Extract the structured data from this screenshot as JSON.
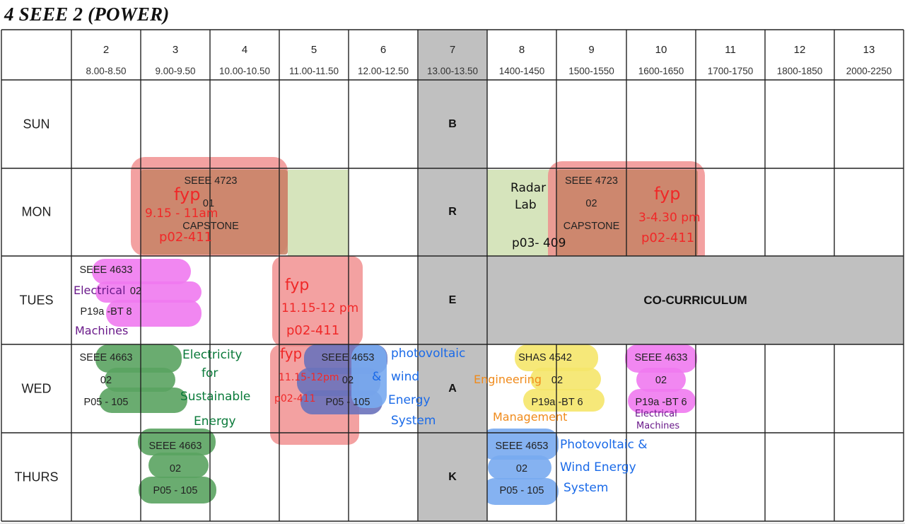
{
  "title": "4 SEEE 2 (POWER)",
  "periods": [
    {
      "num": "2",
      "time": "8.00-8.50"
    },
    {
      "num": "3",
      "time": "9.00-9.50"
    },
    {
      "num": "4",
      "time": "10.00-10.50"
    },
    {
      "num": "5",
      "time": "11.00-11.50"
    },
    {
      "num": "6",
      "time": "12.00-12.50"
    },
    {
      "num": "7",
      "time": "13.00-13.50"
    },
    {
      "num": "8",
      "time": "1400-1450"
    },
    {
      "num": "9",
      "time": "1500-1550"
    },
    {
      "num": "10",
      "time": "1600-1650"
    },
    {
      "num": "11",
      "time": "1700-1750"
    },
    {
      "num": "12",
      "time": "1800-1850"
    },
    {
      "num": "13",
      "time": "2000-2250"
    }
  ],
  "days": [
    "SUN",
    "MON",
    "TUES",
    "WED",
    "THURS"
  ],
  "break_letters": [
    "B",
    "R",
    "E",
    "A",
    "K"
  ],
  "co_curriculum": "CO-CURRICULUM",
  "cells": {
    "mon_p3": [
      "SEEE 4723",
      "01",
      "CAPSTONE"
    ],
    "mon_p9": [
      "SEEE 4723",
      "02",
      "CAPSTONE"
    ],
    "tue_p2": [
      "SEEE 4633",
      "02",
      "P19a -BT 8"
    ],
    "wed_p2": [
      "SEEE 4663",
      "02",
      "P05 - 105"
    ],
    "wed_p5": [
      "SEEE 4653",
      "02",
      "P05 - 105"
    ],
    "wed_p8": [
      "SHAS 4542",
      "02",
      "P19a -BT 6"
    ],
    "wed_p10": [
      "SEEE 4633",
      "02",
      "P19a -BT 6"
    ],
    "thu_p3": [
      "SEEE 4663",
      "02",
      "P05 - 105"
    ],
    "thu_p8": [
      "SEEE 4653",
      "02",
      "P05 - 105"
    ]
  },
  "notes": {
    "mon_fyp1": [
      "fyp",
      "9.15 - 11am",
      "p02-411"
    ],
    "mon_radar": [
      "Radar",
      "Lab",
      "p03- 409"
    ],
    "mon_fyp2": [
      "fyp",
      "3-4.30 pm",
      "p02-411"
    ],
    "tue_elec": [
      "Electrical",
      "Machines"
    ],
    "tue_fyp": [
      "fyp",
      "11.15-12 pm",
      "p02-411"
    ],
    "wed_elec_sust": [
      "Electricity",
      "for",
      "Sustainable",
      "Energy"
    ],
    "wed_fyp": [
      "fyp",
      "11.15-12pm",
      "p02-411"
    ],
    "wed_pv": [
      "photovoltaic",
      "&",
      "wind",
      "Energy",
      "System"
    ],
    "wed_eng": [
      "Engineering",
      "Management"
    ],
    "wed_elec2": [
      "Electrical",
      "Machines"
    ],
    "thu_pv": [
      "Photovoltaic &",
      "Wind  Energy",
      "System"
    ]
  },
  "colors": {
    "break_gray": "#c0c0c0",
    "fyp_red": "#f08a8a",
    "lab_green": "#d6e4bc",
    "capstone_brown": "#c98468",
    "magenta": "#f07af0",
    "green": "#5aa360",
    "blue": "#78aaf0",
    "navy": "#6a72bb",
    "yellow": "#f5e56a",
    "ink_red": "#f02828",
    "ink_green": "#0a7a3a",
    "ink_blue": "#1a6ae8",
    "ink_purple": "#6a1a8a",
    "ink_orange": "#f08a1a",
    "ink_black": "#111111"
  }
}
